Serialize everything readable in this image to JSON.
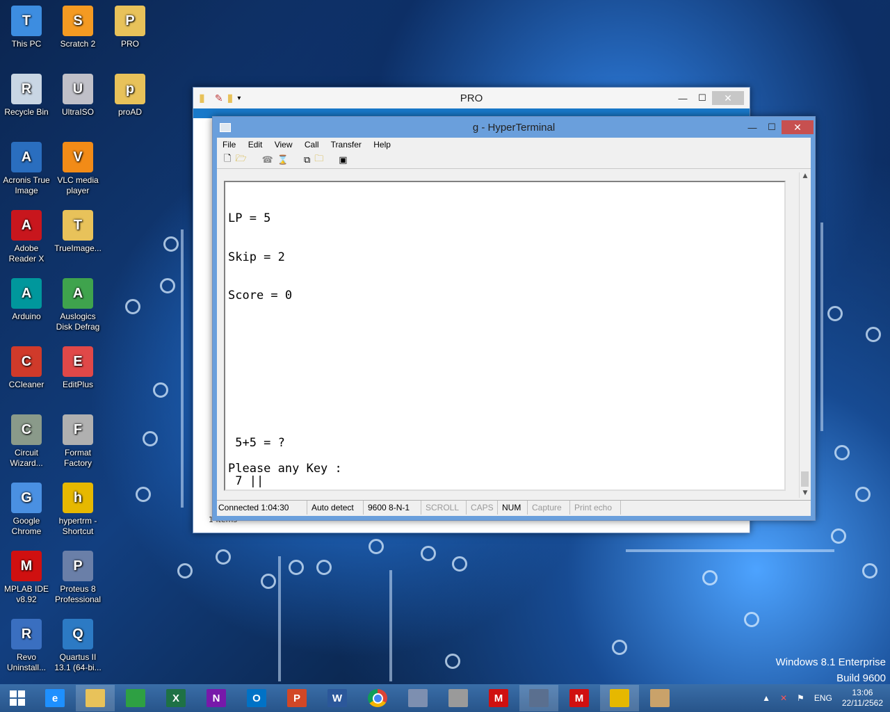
{
  "desktop": {
    "icons": [
      {
        "label": "This PC",
        "icon": "computer-icon",
        "color": "#3d8de0"
      },
      {
        "label": "Scratch 2",
        "icon": "scratch-cat-icon",
        "color": "#f49a22"
      },
      {
        "label": "PRO",
        "icon": "folder-icon",
        "color": "#e8c25a"
      },
      {
        "label": "Recycle Bin",
        "icon": "recycle-bin-icon",
        "color": "#c9d6e4"
      },
      {
        "label": "UltraISO",
        "icon": "disc-icon",
        "color": "#c0c0c8"
      },
      {
        "label": "proAD",
        "icon": "folder-icon",
        "color": "#e8c25a"
      },
      {
        "label": "Acronis True Image",
        "icon": "acronis-icon",
        "color": "#2a6ebf"
      },
      {
        "label": "VLC media player",
        "icon": "vlc-cone-icon",
        "color": "#f28b17"
      },
      {
        "label": "Adobe Reader X",
        "icon": "adobe-reader-icon",
        "color": "#c8161d"
      },
      {
        "label": "TrueImage...",
        "icon": "folder-icon",
        "color": "#e8c25a"
      },
      {
        "label": "Arduino",
        "icon": "arduino-icon",
        "color": "#00979c"
      },
      {
        "label": "Auslogics Disk Defrag",
        "icon": "defrag-icon",
        "color": "#3fa34d"
      },
      {
        "label": "CCleaner",
        "icon": "ccleaner-icon",
        "color": "#d03a2a"
      },
      {
        "label": "EditPlus",
        "icon": "editplus-icon",
        "color": "#e04848"
      },
      {
        "label": "Circuit Wizard...",
        "icon": "circuit-wizard-icon",
        "color": "#8a9a8a"
      },
      {
        "label": "Format Factory",
        "icon": "format-factory-icon",
        "color": "#b0b0b0"
      },
      {
        "label": "Google Chrome",
        "icon": "chrome-icon",
        "color": "#4a90e2"
      },
      {
        "label": "hypertrm - Shortcut",
        "icon": "hyperterminal-icon",
        "color": "#e6b800"
      },
      {
        "label": "MPLAB IDE v8.92",
        "icon": "mplab-icon",
        "color": "#d01010"
      },
      {
        "label": "Proteus 8 Professional",
        "icon": "proteus-icon",
        "color": "#6a7fa8"
      },
      {
        "label": "Revo Uninstall...",
        "icon": "revo-icon",
        "color": "#3a6fc0"
      },
      {
        "label": "Quartus II 13.1 (64-bi...",
        "icon": "quartus-icon",
        "color": "#2c7ac4"
      }
    ],
    "watermark_line1": "Windows 8.1 Enterprise",
    "watermark_line2": "Build 9600"
  },
  "explorer": {
    "title": "PRO",
    "status": "1 items"
  },
  "hyperterminal": {
    "title": "g - HyperTerminal",
    "menu": [
      "File",
      "Edit",
      "View",
      "Call",
      "Transfer",
      "Help"
    ],
    "toolbar_icons": [
      "new-icon",
      "open-icon",
      "disconnect-icon",
      "properties-icon",
      "send-icon",
      "receive-icon",
      "settings-icon"
    ],
    "screen_lines": [
      "LP = 5",
      "Skip = 2",
      "Score = 0"
    ],
    "question": " 5+5 = ?",
    "prompt": "Please any Key :",
    "input": " 7 ||",
    "status": {
      "connected": "Connected 1:04:30",
      "detect": "Auto detect",
      "settings": "9600 8-N-1",
      "scroll": "SCROLL",
      "caps": "CAPS",
      "num": "NUM",
      "capture": "Capture",
      "print_echo": "Print echo"
    }
  },
  "taskbar": {
    "items": [
      {
        "icon": "start-icon",
        "label": "",
        "color": "#ffffff"
      },
      {
        "icon": "internet-explorer-icon",
        "label": "e",
        "color": "#1e90ff"
      },
      {
        "icon": "file-explorer-icon",
        "label": "",
        "color": "#e8c25a"
      },
      {
        "icon": "store-icon",
        "label": "",
        "color": "#2ea043"
      },
      {
        "icon": "excel-icon",
        "label": "X",
        "color": "#1e7145"
      },
      {
        "icon": "onenote-icon",
        "label": "N",
        "color": "#7719aa"
      },
      {
        "icon": "outlook-icon",
        "label": "O",
        "color": "#0072c6"
      },
      {
        "icon": "powerpoint-icon",
        "label": "P",
        "color": "#d24726"
      },
      {
        "icon": "word-icon",
        "label": "W",
        "color": "#2b579a"
      },
      {
        "icon": "chrome-icon",
        "label": "",
        "color": "#4a90e2"
      },
      {
        "icon": "app-icon",
        "label": "",
        "color": "#7d8fb0"
      },
      {
        "icon": "device-icon",
        "label": "",
        "color": "#9a9a9a"
      },
      {
        "icon": "mpasm-icon",
        "label": "M",
        "color": "#d01010"
      },
      {
        "icon": "user-icon",
        "label": "",
        "color": "#5a6f8f"
      },
      {
        "icon": "mplab-icon",
        "label": "M",
        "color": "#d01010"
      },
      {
        "icon": "hyperterminal-icon",
        "label": "",
        "color": "#e6b800"
      },
      {
        "icon": "paint-icon",
        "label": "",
        "color": "#c9a26a"
      }
    ],
    "language": "ENG",
    "time": "13:06",
    "date": "22/11/2562"
  }
}
